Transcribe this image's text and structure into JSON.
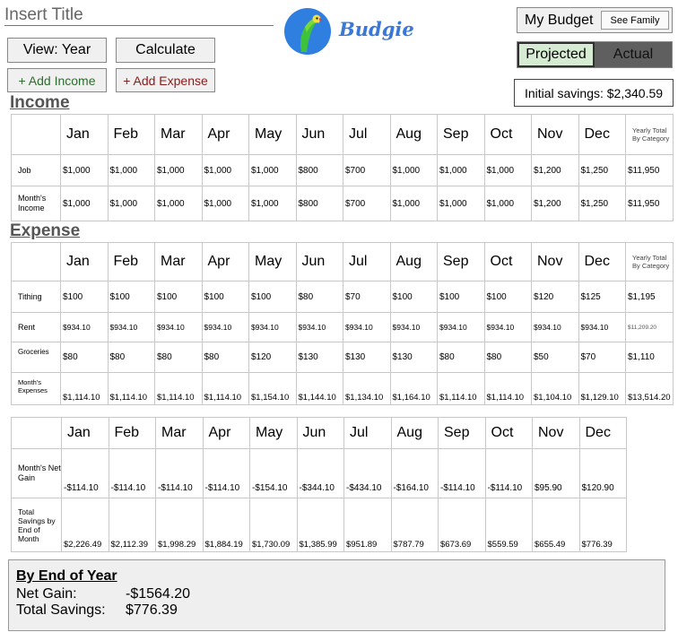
{
  "header": {
    "title": "Insert Title",
    "brand": "Budgie",
    "view_button": "View: Year",
    "calculate_button": "Calculate",
    "add_income_button": "+ Add Income",
    "add_expense_button": "+ Add Expense",
    "my_budget_label": "My Budget",
    "see_family_button": "See Family",
    "projected_label": "Projected",
    "actual_label": "Actual",
    "initial_savings": "Initial savings: $2,340.59"
  },
  "months": [
    "Jan",
    "Feb",
    "Mar",
    "Apr",
    "May",
    "Jun",
    "Jul",
    "Aug",
    "Sep",
    "Oct",
    "Nov",
    "Dec"
  ],
  "yearly_header": "Yearly Total By Category",
  "income": {
    "section_title": "Income",
    "rows": [
      {
        "label": "Job",
        "values": [
          "$1,000",
          "$1,000",
          "$1,000",
          "$1,000",
          "$1,000",
          "$800",
          "$700",
          "$1,000",
          "$1,000",
          "$1,000",
          "$1,200",
          "$1,250"
        ],
        "total": "$11,950"
      },
      {
        "label": "Month's Income",
        "values": [
          "$1,000",
          "$1,000",
          "$1,000",
          "$1,000",
          "$1,000",
          "$800",
          "$700",
          "$1,000",
          "$1,000",
          "$1,000",
          "$1,200",
          "$1,250"
        ],
        "total": "$11,950"
      }
    ]
  },
  "expense": {
    "section_title": "Expense",
    "rows": [
      {
        "label": "Tithing",
        "values": [
          "$100",
          "$100",
          "$100",
          "$100",
          "$100",
          "$80",
          "$70",
          "$100",
          "$100",
          "$100",
          "$120",
          "$125"
        ],
        "total": "$1,195"
      },
      {
        "label": "Rent",
        "values": [
          "$934.10",
          "$934.10",
          "$934.10",
          "$934.10",
          "$934.10",
          "$934.10",
          "$934.10",
          "$934.10",
          "$934.10",
          "$934.10",
          "$934.10",
          "$934.10"
        ],
        "total": "$11,209.20"
      },
      {
        "label": "Groceries",
        "values": [
          "$80",
          "$80",
          "$80",
          "$80",
          "$120",
          "$130",
          "$130",
          "$130",
          "$80",
          "$80",
          "$50",
          "$70"
        ],
        "total": "$1,110"
      },
      {
        "label": "Month's Expenses",
        "values": [
          "$1,114.10",
          "$1,114.10",
          "$1,114.10",
          "$1,114.10",
          "$1,154.10",
          "$1,144.10",
          "$1,134.10",
          "$1,164.10",
          "$1,114.10",
          "$1,114.10",
          "$1,104.10",
          "$1,129.10"
        ],
        "total": "$13,514.20"
      }
    ]
  },
  "net": {
    "rows": [
      {
        "label": "Month's Net Gain",
        "values": [
          "-$114.10",
          "-$114.10",
          "-$114.10",
          "-$114.10",
          "-$154.10",
          "-$344.10",
          "-$434.10",
          "-$164.10",
          "-$114.10",
          "-$114.10",
          "$95.90",
          "$120.90"
        ]
      },
      {
        "label": "Total Savings by End of Month",
        "values": [
          "$2,226.49",
          "$2,112.39",
          "$1,998.29",
          "$1,884.19",
          "$1,730.09",
          "$1,385.99",
          "$951.89",
          "$787.79",
          "$673.69",
          "$559.59",
          "$655.49",
          "$776.39"
        ]
      }
    ]
  },
  "summary": {
    "heading": "By End of Year",
    "net_gain_label": "Net Gain:",
    "net_gain_value": "-$1564.20",
    "total_savings_label": "Total Savings:",
    "total_savings_value": "$776.39"
  },
  "colors": {
    "brand": "#3a78d6",
    "projected_bg": "#d6ecd2",
    "actual_bg": "#5f5f5f",
    "add_income_text": "#2e6b2e",
    "add_expense_text": "#8b1a1a"
  }
}
